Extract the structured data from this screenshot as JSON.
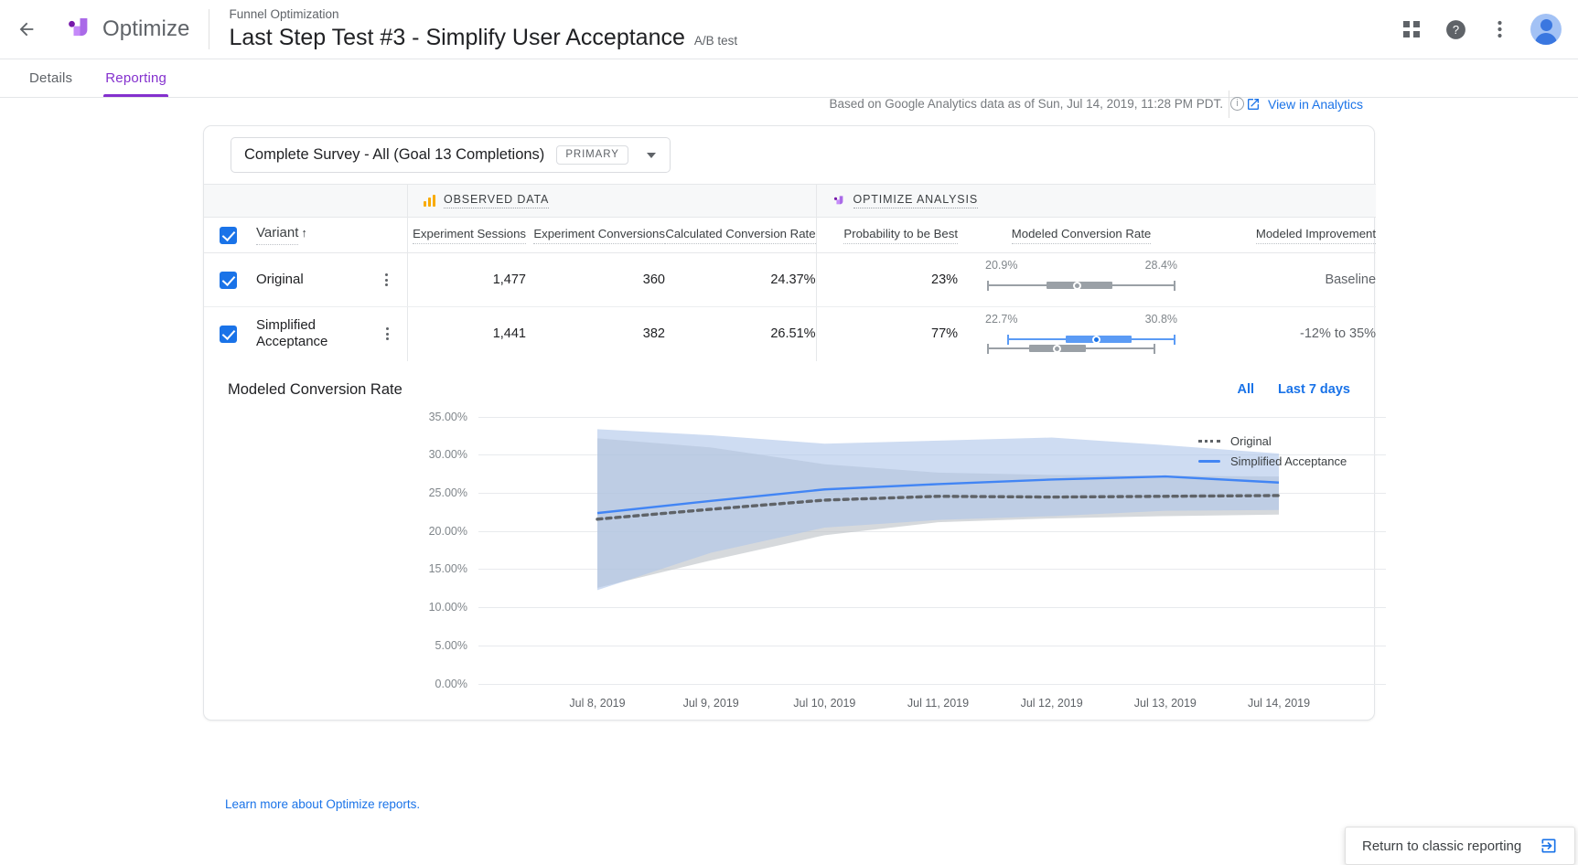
{
  "appbar": {
    "back_label": "←",
    "product_name": "Optimize",
    "eyebrow": "Funnel Optimization",
    "experiment_title": "Last Step Test #3 - Simplify User Acceptance",
    "experiment_type": "A/B test",
    "apps_icon": "apps-grid-icon",
    "help_icon": "help-icon",
    "more_icon": "more-vert-icon",
    "avatar": "user-avatar"
  },
  "tabs": [
    {
      "label": "Details",
      "active": false
    },
    {
      "label": "Reporting",
      "active": true
    }
  ],
  "meta": {
    "data_freshness": "Based on Google Analytics data as of Sun, Jul 14, 2019, 11:28 PM PDT.",
    "view_in_analytics": "View in Analytics"
  },
  "goal": {
    "name": "Complete Survey - All (Goal 13 Completions)",
    "badge": "PRIMARY"
  },
  "table": {
    "groups": [
      {
        "label": "OBSERVED DATA",
        "icon": "analytics-bars-icon"
      },
      {
        "label": "OPTIMIZE ANALYSIS",
        "icon": "optimize-logo-icon"
      }
    ],
    "headers": {
      "variant": "Variant",
      "sort_arrow": "↑",
      "experiment_sessions": "Experiment Sessions",
      "experiment_conversions": "Experiment Conversions",
      "calculated_conversion_rate": "Calculated Conversion Rate",
      "probability_to_be_best": "Probability to be Best",
      "modeled_conversion_rate": "Modeled Conversion Rate",
      "modeled_improvement": "Modeled Improvement"
    },
    "rows": [
      {
        "name": "Original",
        "checked": true,
        "sessions": "1,477",
        "conversions": "360",
        "calc_rate": "24.37%",
        "prob_best": "23%",
        "range_low": "20.9%",
        "range_high": "28.4%",
        "improvement": "Baseline",
        "color": "#9aa0a6"
      },
      {
        "name": "Simplified Acceptance",
        "checked": true,
        "sessions": "1,441",
        "conversions": "382",
        "calc_rate": "26.51%",
        "prob_best": "77%",
        "range_low": "22.7%",
        "range_high": "30.8%",
        "improvement": "-12% to 35%",
        "color": "#5b9bf5"
      }
    ]
  },
  "chart_section": {
    "title": "Modeled Conversion Rate",
    "actions": [
      "All",
      "Last 7 days"
    ]
  },
  "chart_data": {
    "type": "area",
    "title": "Modeled Conversion Rate",
    "xlabel": "",
    "ylabel": "",
    "ylim": [
      0,
      35
    ],
    "grid": true,
    "legend_position": "right",
    "ytick_labels": [
      "35.00%",
      "30.00%",
      "25.00%",
      "20.00%",
      "15.00%",
      "10.00%",
      "5.00%",
      "0.00%"
    ],
    "ytick_values": [
      35,
      30,
      25,
      20,
      15,
      10,
      5,
      0
    ],
    "x": [
      "Jul 8, 2019",
      "Jul 9, 2019",
      "Jul 10, 2019",
      "Jul 11, 2019",
      "Jul 12, 2019",
      "Jul 13, 2019",
      "Jul 14, 2019"
    ],
    "series": [
      {
        "name": "Original",
        "style": "dashed",
        "color": "#5f6368",
        "band_color": "#bdc1c6",
        "values": [
          21.6,
          22.9,
          24.1,
          24.6,
          24.5,
          24.6,
          24.7
        ],
        "band_upper": [
          32.2,
          31.0,
          28.8,
          27.7,
          27.4,
          27.3,
          27.2
        ],
        "band_lower": [
          12.6,
          16.2,
          19.5,
          21.2,
          21.7,
          22.0,
          22.2
        ]
      },
      {
        "name": "Simplified Acceptance",
        "style": "solid",
        "color": "#4285f4",
        "band_color": "#aec5ea",
        "values": [
          22.4,
          24.0,
          25.5,
          26.2,
          26.8,
          27.2,
          26.4
        ],
        "band_upper": [
          33.4,
          32.6,
          31.5,
          31.9,
          32.3,
          31.3,
          30.2
        ],
        "band_lower": [
          12.3,
          17.2,
          20.5,
          21.5,
          22.0,
          22.7,
          22.8
        ]
      }
    ]
  },
  "footer": {
    "learn_more": "Learn more about Optimize reports."
  },
  "return_button": {
    "label": "Return to classic reporting",
    "icon": "exit-to-app-icon"
  },
  "colors": {
    "brand_purple": "#8430ce",
    "link_blue": "#1a73e8",
    "variant_blue": "#4285f4",
    "original_gray": "#5f6368"
  }
}
